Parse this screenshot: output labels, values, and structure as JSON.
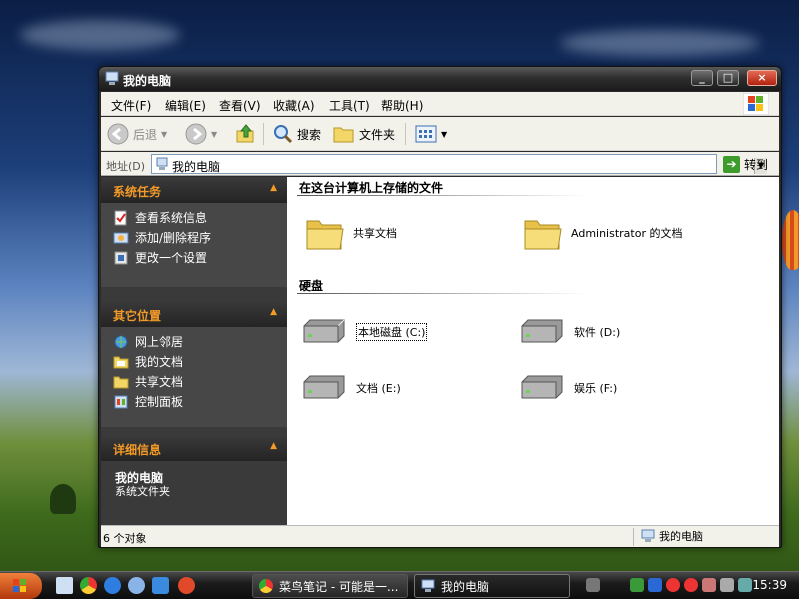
{
  "window": {
    "title": "我的电脑",
    "controls": {
      "minimize": "_",
      "maximize": "□",
      "close": "×"
    }
  },
  "menu": [
    "文件(F)",
    "编辑(E)",
    "查看(V)",
    "收藏(A)",
    "工具(T)",
    "帮助(H)"
  ],
  "toolbar": {
    "back": "后退",
    "search": "搜索",
    "folders": "文件夹"
  },
  "address": {
    "label": "地址(D)",
    "value": "我的电脑",
    "go": "转到"
  },
  "system_tasks": {
    "title": "系统任务",
    "items": [
      "查看系统信息",
      "添加/删除程序",
      "更改一个设置"
    ]
  },
  "other_places": {
    "title": "其它位置",
    "items": [
      "网上邻居",
      "我的文档",
      "共享文档",
      "控制面板"
    ]
  },
  "details": {
    "title": "详细信息",
    "name": "我的电脑",
    "sub": "系统文件夹"
  },
  "content": {
    "files_group": "在这台计算机上存储的文件",
    "folders": [
      "共享文档",
      "Administrator 的文档"
    ],
    "drives_group": "硬盘",
    "drives": [
      "本地磁盘 (C:)",
      "软件 (D:)",
      "文档 (E:)",
      "娱乐 (F:)"
    ]
  },
  "status": {
    "count": "6 个对象",
    "location": "我的电脑"
  },
  "taskbar": {
    "tasks": [
      "菜鸟笔记 - 可能是一...",
      "我的电脑"
    ],
    "clock": "15:39"
  },
  "colors": {
    "panel_header": "#f39a27",
    "dark_pane": "#474747",
    "folder": "#f3d766"
  }
}
